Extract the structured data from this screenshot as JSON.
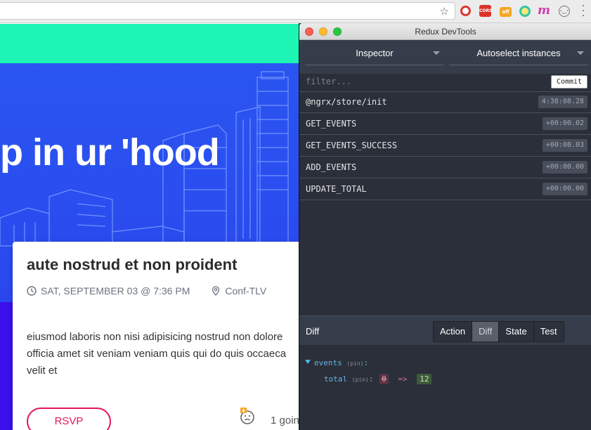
{
  "browser": {
    "star_icon": "star-icon",
    "extensions": [
      "opera-icon",
      "cors-icon",
      "off-icon",
      "circle-icon",
      "m-icon",
      "face-icon"
    ],
    "cors_label": "CORS",
    "off_label": "off",
    "m_label": "m",
    "face_label": "(·_·)",
    "menu_icon": "vertical-dots-icon"
  },
  "page": {
    "hero_title": "p in ur 'hood",
    "event": {
      "title": "aute nostrud et non proident",
      "date": "SAT, SEPTEMBER 03 @ 7:36 PM",
      "location": "Conf-TLV",
      "description": "eiusmod laboris non nisi adipisicing nostrud non dolore\nofficia amet sit veniam veniam quis qui do quis occaeca\nvelit et",
      "rsvp_label": "RSVP",
      "attending_text": "1 goin"
    },
    "colors": {
      "accent": "#e5135e",
      "hero": "#2a55f0",
      "topband": "#1df5b4"
    }
  },
  "devtools": {
    "window_title": "Redux DevTools",
    "monitor_select": "Inspector",
    "instance_select": "Autoselect instances",
    "filter_placeholder": "filter...",
    "commit_label": "Commit",
    "actions": [
      {
        "name": "@ngrx/store/init",
        "time": "4:38:08.28"
      },
      {
        "name": "GET_EVENTS",
        "time": "+00:00.02"
      },
      {
        "name": "GET_EVENTS_SUCCESS",
        "time": "+00:08.03"
      },
      {
        "name": "ADD_EVENTS",
        "time": "+00:00.00"
      },
      {
        "name": "UPDATE_TOTAL",
        "time": "+00:00.00"
      }
    ],
    "panel_label": "Diff",
    "tabs": [
      "Action",
      "Diff",
      "State",
      "Test"
    ],
    "active_tab": "Diff",
    "diff": {
      "key": "events",
      "pin": "(pin)",
      "colon": ":",
      "child_key": "total",
      "child_pin": "(pin)",
      "child_colon": ":",
      "old_value": "0",
      "arrow": "=>",
      "new_value": "12"
    }
  }
}
